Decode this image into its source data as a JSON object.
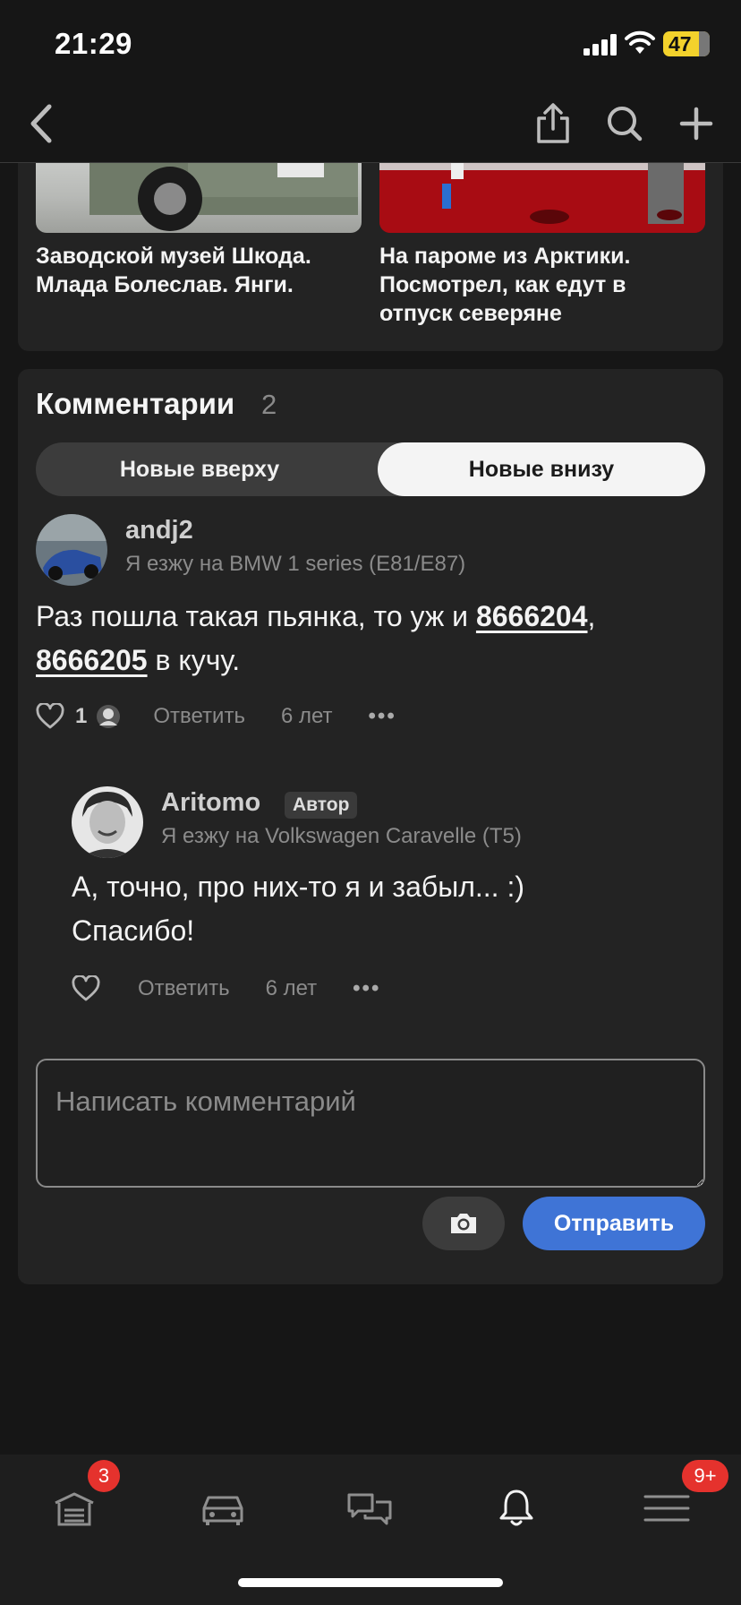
{
  "status": {
    "time": "21:29",
    "battery": "47"
  },
  "nav": {
    "back_icon": "chevron-left-icon",
    "share_icon": "share-icon",
    "search_icon": "search-icon",
    "add_icon": "plus-icon"
  },
  "related": [
    {
      "title": "Заводской музей Шкода. Млада Болеслав. Янги."
    },
    {
      "title": "На пароме из Арктики. Посмотрел, как едут в отпуск северяне"
    }
  ],
  "comments": {
    "heading": "Комментарии",
    "count": "2",
    "sort": {
      "newest_top": "Новые вверху",
      "newest_bottom": "Новые внизу",
      "selected": "Новые внизу"
    },
    "items": [
      {
        "user": "andj2",
        "car": "Я езжу на BMW 1 series (E81/E87)",
        "text_before": "Раз пошла такая пьянка, то уж и ",
        "link1": "8666204",
        "text_mid": ", ",
        "link2": "8666205",
        "text_after": " в кучу.",
        "likes": "1",
        "reply": "Ответить",
        "age": "6 лет",
        "more": "•••"
      },
      {
        "user": "Aritomo",
        "badge": "Автор",
        "car": "Я езжу на Volkswagen Caravelle (T5)",
        "text_line1": "А, точно, про них-то я и забыл... :)",
        "text_line2": "Спасибо!",
        "reply": "Ответить",
        "age": "6 лет",
        "more": "•••"
      }
    ],
    "input_placeholder": "Написать комментарий",
    "send_label": "Отправить"
  },
  "tabbar": {
    "garage_badge": "3",
    "menu_badge": "9+"
  },
  "colors": {
    "accent": "#3f74d6",
    "badge": "#e5322d",
    "background": "#161616",
    "card": "#232323"
  }
}
